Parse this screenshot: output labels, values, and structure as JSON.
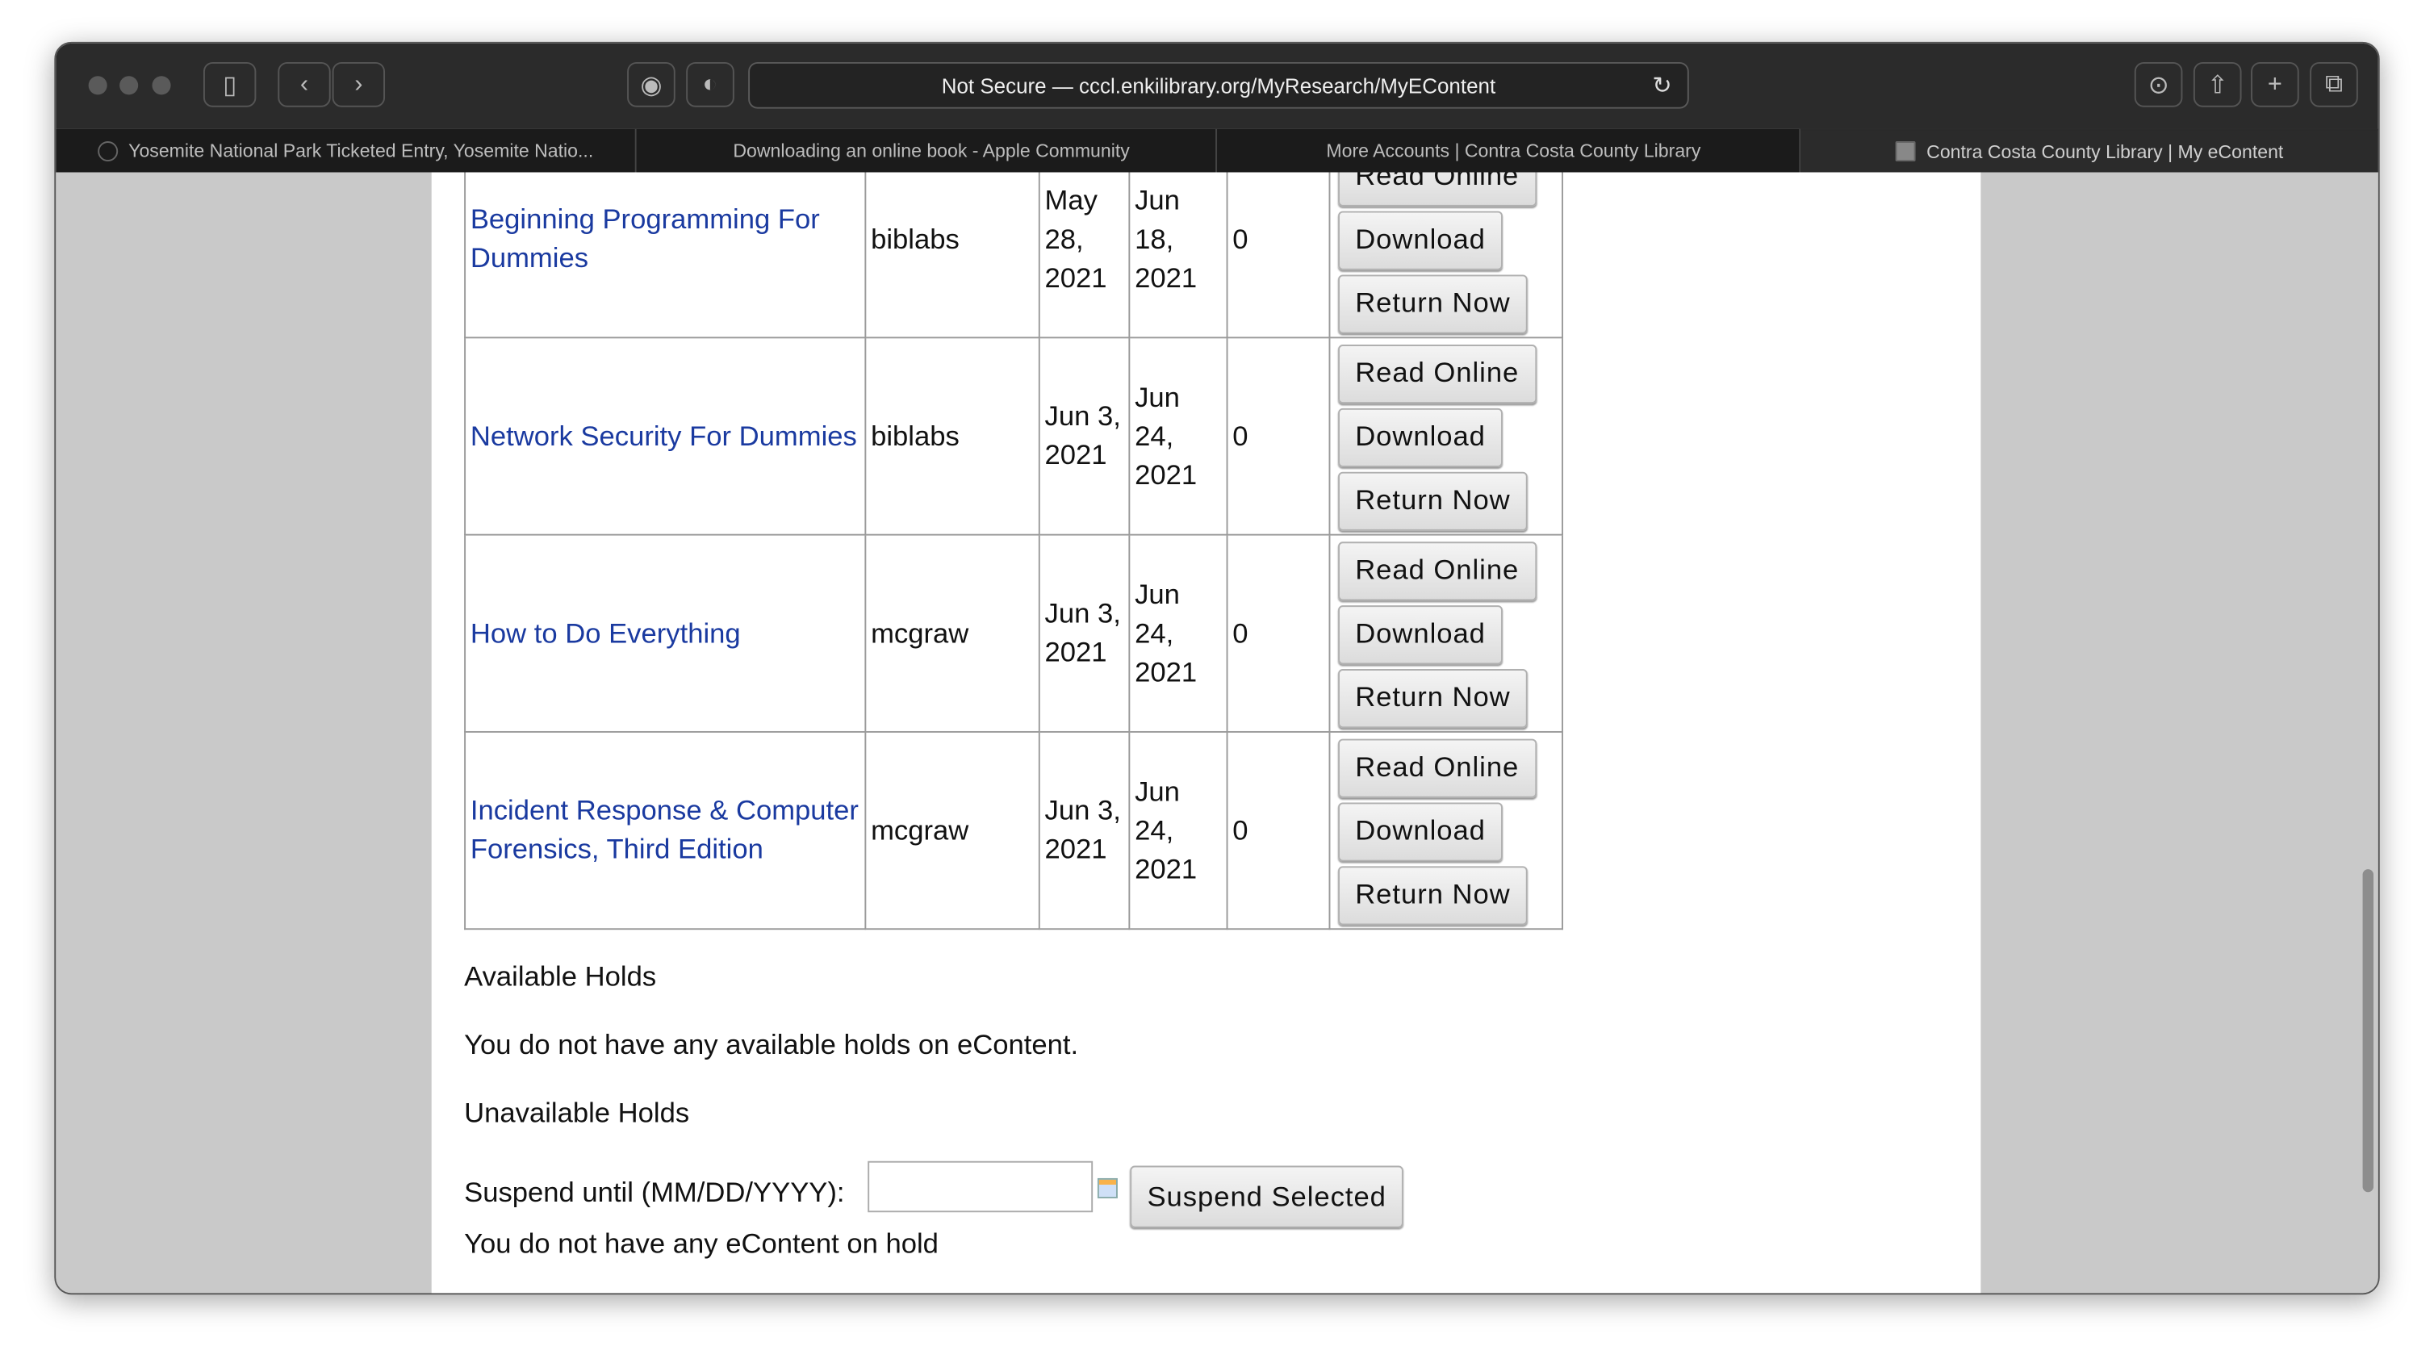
{
  "browser": {
    "url": "Not Secure — cccl.enkilibrary.org/MyResearch/MyEContent",
    "tabs": [
      {
        "label": "Yosemite National Park Ticketed Entry, Yosemite Natio...",
        "active": false
      },
      {
        "label": "Downloading an online book - Apple Community",
        "active": false
      },
      {
        "label": "More Accounts | Contra Costa County Library",
        "active": false
      },
      {
        "label": "Contra Costa County Library | My eContent",
        "active": true
      }
    ]
  },
  "checkouts": {
    "buttons": {
      "read": "Read Online",
      "download": "Download",
      "return": "Return Now"
    },
    "rows": [
      {
        "title": "Beginning Programming For Dummies",
        "source": "biblabs",
        "checked_out": "May 28, 2021",
        "due": "Jun 18, 2021",
        "count": "0"
      },
      {
        "title": "Network Security For Dummies",
        "source": "biblabs",
        "checked_out": "Jun 3, 2021",
        "due": "Jun 24, 2021",
        "count": "0"
      },
      {
        "title": "How to Do Everything",
        "source": "mcgraw",
        "checked_out": "Jun 3, 2021",
        "due": "Jun 24, 2021",
        "count": "0"
      },
      {
        "title": "Incident Response & Computer Forensics, Third Edition",
        "source": "mcgraw",
        "checked_out": "Jun 3, 2021",
        "due": "Jun 24, 2021",
        "count": "0"
      }
    ]
  },
  "available_holds": {
    "heading": "Available Holds",
    "message": "You do not have any available holds on eContent."
  },
  "unavailable_holds": {
    "heading": "Unavailable Holds",
    "suspend_label": "Suspend until (MM/DD/YYYY):",
    "suspend_value": "",
    "suspend_button": "Suspend Selected",
    "message": "You do not have any eContent on hold"
  },
  "colors": {
    "link": "#1a3aa0",
    "toolbar": "#2b2b2b"
  }
}
